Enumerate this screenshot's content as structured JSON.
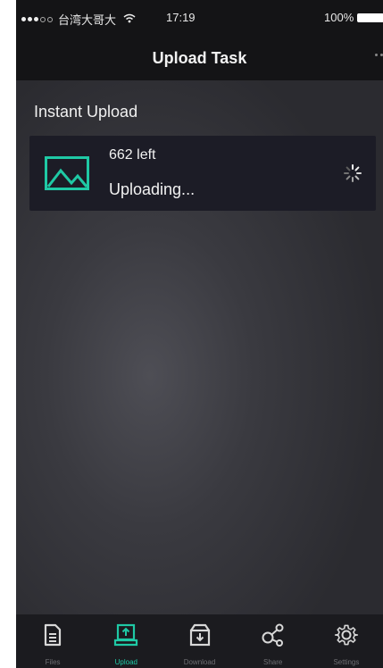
{
  "status_bar": {
    "carrier": "台湾大哥大",
    "time": "17:19",
    "battery": "100%"
  },
  "header": {
    "title": "Upload Task"
  },
  "section": {
    "title": "Instant Upload"
  },
  "task": {
    "count_text": "662 left",
    "status_text": "Uploading..."
  },
  "tabs": [
    {
      "label": "Files",
      "icon": "files-icon",
      "active": false
    },
    {
      "label": "Upload",
      "icon": "upload-icon",
      "active": true
    },
    {
      "label": "Download",
      "icon": "download-icon",
      "active": false
    },
    {
      "label": "Share",
      "icon": "share-icon",
      "active": false
    },
    {
      "label": "Settings",
      "icon": "gear-icon",
      "active": false
    }
  ],
  "colors": {
    "accent": "#1fc9a5",
    "bar_background": "#141416",
    "card_background": "#1c1c26"
  }
}
